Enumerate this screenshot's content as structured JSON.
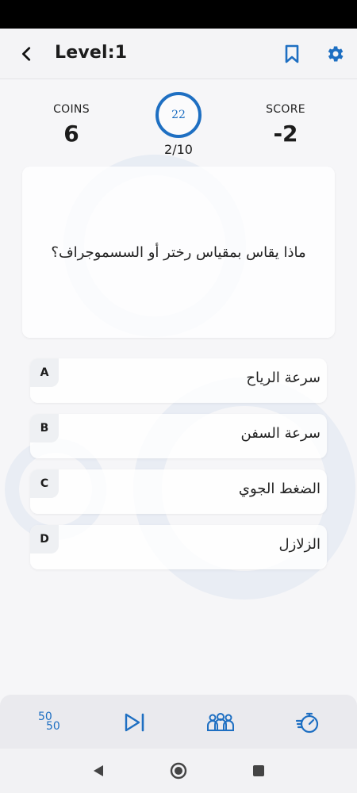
{
  "header": {
    "title": "Level:1"
  },
  "stats": {
    "coins_label": "COINS",
    "coins_value": "6",
    "score_label": "SCORE",
    "score_value": "-2",
    "timer_value": "22",
    "progress": "2/10"
  },
  "question": {
    "text": "ماذا يقاس بمقياس رختر أو السسموجراف؟"
  },
  "options": [
    {
      "letter": "A",
      "text": "سرعة الرياح"
    },
    {
      "letter": "B",
      "text": "سرعة السفن"
    },
    {
      "letter": "C",
      "text": "الضغط الجوي"
    },
    {
      "letter": "D",
      "text": "الزلازل"
    }
  ],
  "lifelines": {
    "fifty_top": "50",
    "fifty_bottom": "50"
  },
  "icons": [
    "back-arrow-icon",
    "bookmark-icon",
    "gear-icon",
    "fifty-fifty-icon",
    "skip-icon",
    "audience-icon",
    "stopwatch-icon",
    "nav-back-icon",
    "nav-home-icon",
    "nav-recent-icon"
  ],
  "colors": {
    "accent": "#1e6fc2",
    "background": "#f6f6f8"
  }
}
